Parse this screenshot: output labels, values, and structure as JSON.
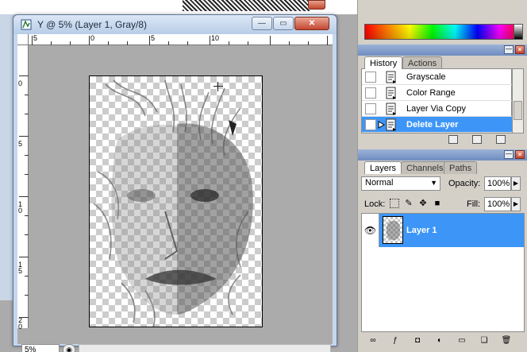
{
  "document": {
    "title": "Y @ 5% (Layer 1, Gray/8)",
    "zoom": "5%",
    "ruler_h_labels": [
      "5",
      "0",
      "5",
      "10"
    ],
    "ruler_v_labels": [
      "0",
      "5",
      "10",
      "15",
      "20"
    ]
  },
  "history": {
    "tabs": [
      {
        "label": "History",
        "active": true
      },
      {
        "label": "Actions",
        "active": false
      }
    ],
    "items": [
      {
        "label": "Grayscale",
        "selected": false
      },
      {
        "label": "Color Range",
        "selected": false
      },
      {
        "label": "Layer Via Copy",
        "selected": false
      },
      {
        "label": "Delete Layer",
        "selected": true
      }
    ]
  },
  "layers": {
    "tabs": [
      {
        "label": "Layers",
        "active": true
      },
      {
        "label": "Channels",
        "active": false
      },
      {
        "label": "Paths",
        "active": false
      }
    ],
    "blend_mode": "Normal",
    "opacity_label": "Opacity:",
    "opacity": "100%",
    "lock_label": "Lock:",
    "fill_label": "Fill:",
    "fill": "100%",
    "items": [
      {
        "name": "Layer 1",
        "visible": true,
        "selected": true
      }
    ]
  },
  "colors": {
    "selection": "#3d96f7",
    "canvas_bg": "#ababab"
  }
}
